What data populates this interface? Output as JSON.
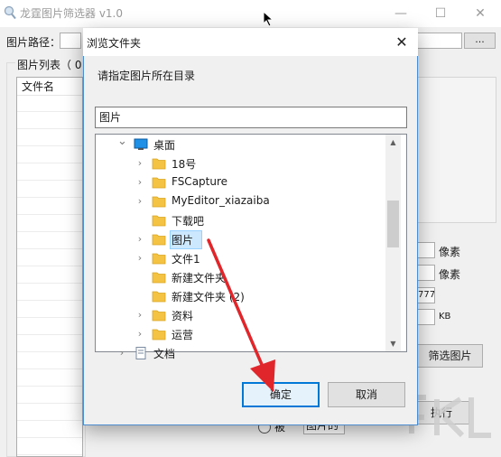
{
  "app": {
    "title": "龙霆图片筛选器 v1.0",
    "window_buttons": {
      "minimize": "—",
      "maximize": "☐",
      "close": "✕"
    },
    "path_label": "图片路径：",
    "browse_label": "...",
    "list_group_label": "图片列表（ 0",
    "list_column_header": "文件名",
    "px_label_1": "像素",
    "px_label_2": "像素",
    "color_value": "777",
    "kb_label": "KB",
    "filter_button": "筛选图片",
    "execute_button": "执行",
    "bottom_radio_label": "被",
    "bottom_field_value": "图片的"
  },
  "dialog": {
    "title": "浏览文件夹",
    "close_glyph": "✕",
    "instruction": "请指定图片所在目录",
    "folder_name": "图片",
    "tree": [
      {
        "label": "桌面",
        "icon": "desktop-icon",
        "chevron": "expanded",
        "level": 0
      },
      {
        "label": "18号",
        "icon": "folder-icon",
        "chevron": "collapsed",
        "level": 1
      },
      {
        "label": "FSCapture",
        "icon": "folder-icon",
        "chevron": "collapsed",
        "level": 1
      },
      {
        "label": "MyEditor_xiazaiba",
        "icon": "folder-icon",
        "chevron": "collapsed",
        "level": 1
      },
      {
        "label": "下载吧",
        "icon": "folder-icon",
        "chevron": "none",
        "level": 1
      },
      {
        "label": "图片",
        "icon": "folder-icon",
        "chevron": "collapsed",
        "level": 1,
        "selected": true
      },
      {
        "label": "文件1",
        "icon": "folder-icon",
        "chevron": "collapsed",
        "level": 1
      },
      {
        "label": "新建文件夹",
        "icon": "folder-icon",
        "chevron": "none",
        "level": 1
      },
      {
        "label": "新建文件夹 (2)",
        "icon": "folder-icon",
        "chevron": "none",
        "level": 1
      },
      {
        "label": "资料",
        "icon": "folder-icon",
        "chevron": "collapsed",
        "level": 1
      },
      {
        "label": "运营",
        "icon": "folder-icon",
        "chevron": "collapsed",
        "level": 1
      },
      {
        "label": "文档",
        "icon": "document-icon",
        "chevron": "collapsed",
        "level": 0
      }
    ],
    "ok_button": "确定",
    "cancel_button": "取消"
  },
  "colors": {
    "accent": "#0078d7",
    "selection": "#cce8ff",
    "folder": "#f5c343",
    "arrow": "#e0262b"
  }
}
